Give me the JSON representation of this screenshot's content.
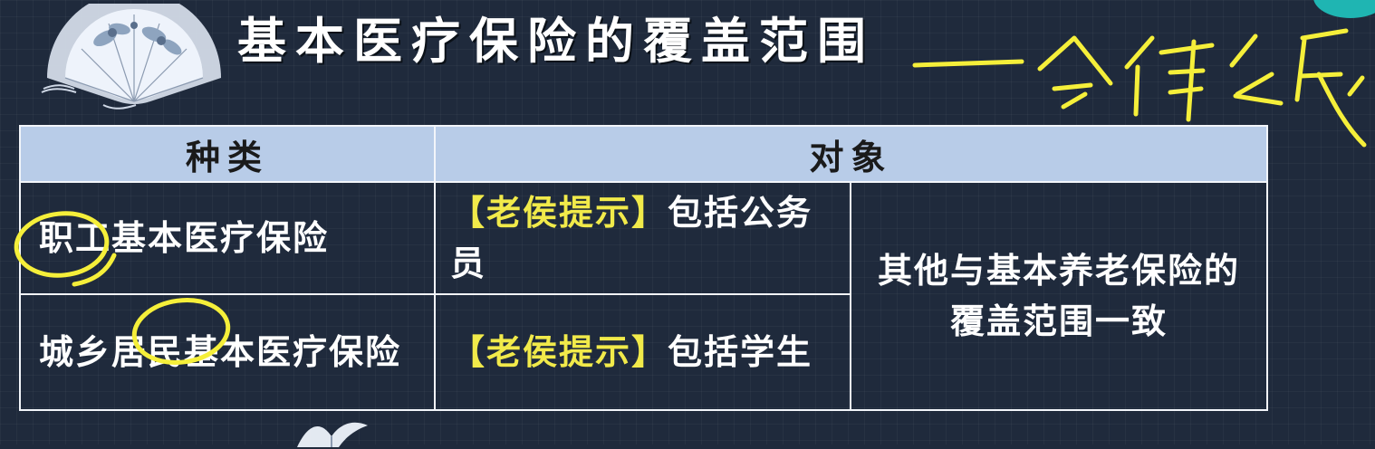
{
  "title": "基本医疗保险的覆盖范围",
  "annotation_text": "全体公民",
  "table": {
    "headers": [
      "种类",
      "对象"
    ],
    "rows": [
      {
        "type": "职工基本医疗保险",
        "tip_label": "【老侯提示】",
        "description": "包括公务员"
      },
      {
        "type": "城乡居民基本医疗保险",
        "tip_label": "【老侯提示】",
        "description": "包括学生"
      }
    ],
    "shared_note": "其他与基本养老保险的覆盖范围一致"
  },
  "colors": {
    "background": "#1f2a3c",
    "header_fill": "#b8cce8",
    "highlight": "#f1ea4a",
    "ink": "#f5ef3a"
  },
  "icons": [
    "fan-decoration-icon",
    "butterfly-icon"
  ]
}
